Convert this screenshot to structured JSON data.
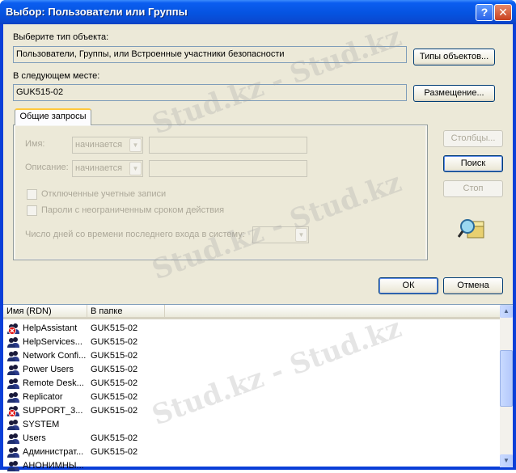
{
  "window": {
    "title": "Выбор: Пользователи или Группы"
  },
  "object_type": {
    "label": "Выберите тип объекта:",
    "value": "Пользователи, Группы, или Встроенные участники безопасности",
    "button": "Типы объектов..."
  },
  "location": {
    "label": "В следующем месте:",
    "value": "GUK515-02",
    "button": "Размещение..."
  },
  "query": {
    "tab": "Общие запросы",
    "name_label": "Имя:",
    "name_mode": "начинается",
    "desc_label": "Описание:",
    "desc_mode": "начинается",
    "disabled_accounts": "Отключенные учетные записи",
    "nonexpiring_pwd": "Пароли с неограниченным сроком действия",
    "days_label": "Число дней со времени последнего входа в систему:"
  },
  "side_buttons": {
    "columns": "Столбцы...",
    "search": "Поиск",
    "stop": "Стоп"
  },
  "dialog_buttons": {
    "ok": "ОК",
    "cancel": "Отмена"
  },
  "results": {
    "columns": [
      "Имя (RDN)",
      "В папке"
    ],
    "rows": [
      {
        "name": "HelpAssistant",
        "folder": "GUK515-02",
        "disabled": true
      },
      {
        "name": "HelpServices...",
        "folder": "GUK515-02",
        "disabled": false
      },
      {
        "name": "Network Confi...",
        "folder": "GUK515-02",
        "disabled": false
      },
      {
        "name": "Power Users",
        "folder": "GUK515-02",
        "disabled": false
      },
      {
        "name": "Remote Desk...",
        "folder": "GUK515-02",
        "disabled": false
      },
      {
        "name": "Replicator",
        "folder": "GUK515-02",
        "disabled": false
      },
      {
        "name": "SUPPORT_3...",
        "folder": "GUK515-02",
        "disabled": true
      },
      {
        "name": "SYSTEM",
        "folder": "",
        "disabled": false
      },
      {
        "name": "Users",
        "folder": "GUK515-02",
        "disabled": false
      },
      {
        "name": "Администрат...",
        "folder": "GUK515-02",
        "disabled": false
      },
      {
        "name": "АНОНИМНЫ...",
        "folder": "",
        "disabled": false
      }
    ]
  },
  "watermark": "Stud.kz - Stud.kz"
}
